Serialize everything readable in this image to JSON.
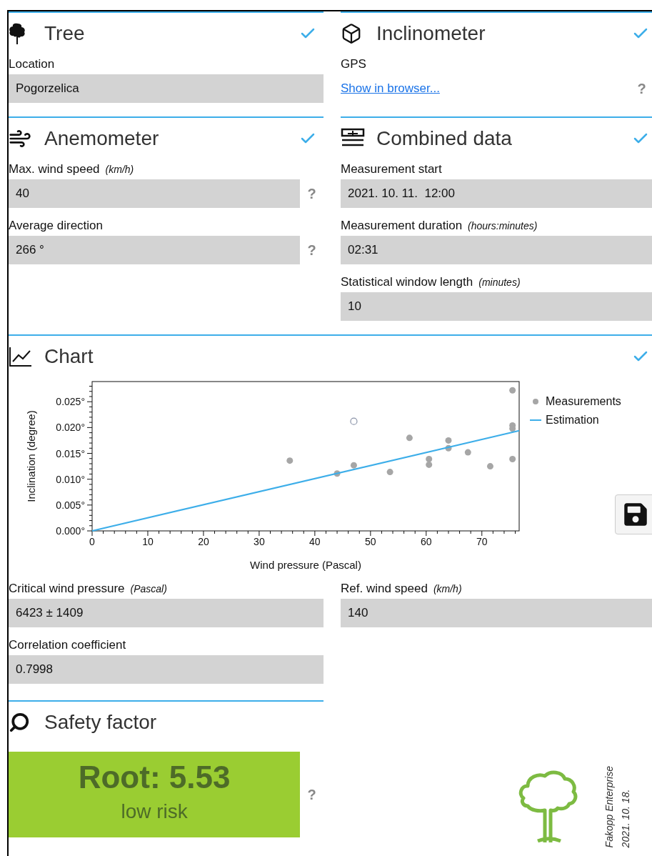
{
  "top_sections": [
    {
      "kind": "tree",
      "title": "Tree",
      "checked": true,
      "fields": [
        {
          "kind": "text",
          "label": "Location",
          "value": "Pogorzelica"
        }
      ]
    },
    {
      "kind": "inclinometer",
      "title": "Inclinometer",
      "checked": true,
      "fields": [
        {
          "kind": "link",
          "label": "GPS",
          "link": "Show in browser...",
          "help": "?"
        }
      ]
    },
    {
      "kind": "anemometer",
      "title": "Anemometer",
      "checked": true,
      "fields": [
        {
          "kind": "text",
          "label": "Max. wind speed",
          "unit": "(km/h)",
          "value": "40",
          "help": "?"
        },
        {
          "kind": "text",
          "label": "Average direction",
          "value": "266 °",
          "help": "?"
        }
      ]
    },
    {
      "kind": "combined",
      "title": "Combined data",
      "checked": true,
      "fields": [
        {
          "kind": "text",
          "label": "Measurement start",
          "value": "2021. 10. 11.  12:00"
        },
        {
          "kind": "text",
          "label": "Measurement duration",
          "unit": "(hours:minutes)",
          "value": "02:31"
        },
        {
          "kind": "text",
          "label": "Statistical window length",
          "unit": "(minutes)",
          "value": "10"
        }
      ]
    }
  ],
  "chart_section": {
    "title": "Chart",
    "checked": true,
    "chart_data": {
      "type": "scatter",
      "xlabel": "Wind pressure (Pascal)",
      "ylabel": "Inclination (degree)",
      "xlim": [
        0,
        76.7
      ],
      "ylim": [
        0,
        0.0289
      ],
      "xticks": [
        {
          "value": 0,
          "label": "0"
        },
        {
          "value": 10,
          "label": "10"
        },
        {
          "value": 20,
          "label": "20"
        },
        {
          "value": 30,
          "label": "30"
        },
        {
          "value": 40,
          "label": "40"
        },
        {
          "value": 50,
          "label": "50"
        },
        {
          "value": 60,
          "label": "60"
        },
        {
          "value": 70,
          "label": "70"
        }
      ],
      "yticks": [
        {
          "value": 0,
          "label": "0.000°"
        },
        {
          "value": 0.005,
          "label": "0.005°"
        },
        {
          "value": 0.01,
          "label": "0.010°"
        },
        {
          "value": 0.015,
          "label": "0.015°"
        },
        {
          "value": 0.02,
          "label": "0.020°"
        },
        {
          "value": 0.025,
          "label": "0.025°"
        }
      ],
      "series": [
        {
          "name": "Measurements",
          "color": "#a6a6a6",
          "x": [
            35.5,
            44,
            47,
            53.5,
            57,
            60.5,
            60.5,
            64,
            64,
            67.5,
            71.5,
            75.5,
            75.5,
            75.5,
            75.5
          ],
          "values": [
            0.0136,
            0.0111,
            0.0127,
            0.0114,
            0.018,
            0.0139,
            0.0128,
            0.0175,
            0.016,
            0.0152,
            0.0125,
            0.0272,
            0.0204,
            0.0198,
            0.0139
          ]
        },
        {
          "name": "Estimation",
          "type": "line",
          "color": "#3daee9",
          "x": [
            0,
            76.7
          ],
          "values": [
            0,
            0.0194
          ]
        },
        {
          "color": "#8a93a8",
          "x": [
            47
          ],
          "values": [
            0.0212
          ]
        }
      ]
    }
  },
  "results": {
    "left": [
      {
        "label": "Critical wind pressure",
        "unit": "(Pascal)",
        "value": "6423 ± 1409"
      },
      {
        "label": "Correlation coefficient",
        "value": "0.7998"
      }
    ],
    "right": [
      {
        "label": "Ref. wind speed",
        "unit": "(km/h)",
        "value": "140"
      }
    ]
  },
  "safety": {
    "title": "Safety factor",
    "headline": "Root: 5.53",
    "risk": "low risk",
    "color": "#9acd32",
    "help": "?"
  },
  "footer": {
    "company": "Fakopp Enterprise",
    "date": "2021. 10. 18."
  }
}
